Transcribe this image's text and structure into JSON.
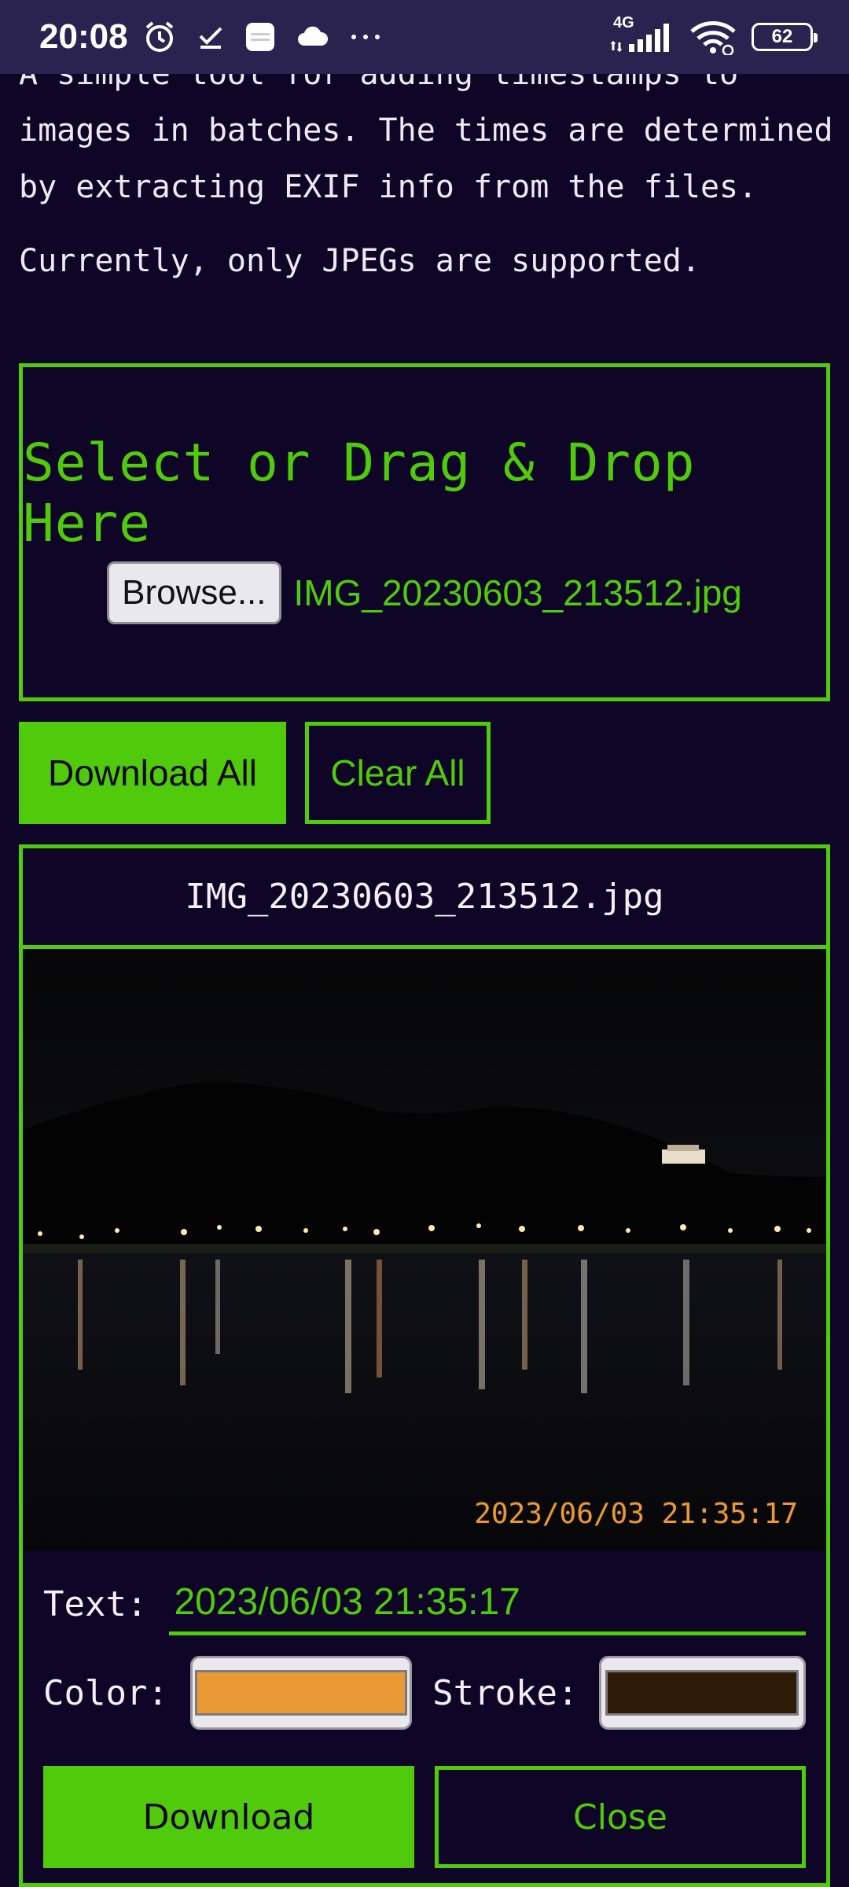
{
  "status_bar": {
    "time": "20:08",
    "network": "4G",
    "battery": "62",
    "icons_left": [
      "alarm-icon",
      "check-icon",
      "app-icon",
      "cloud-icon",
      "more-dots-icon"
    ],
    "icons_right": [
      "signal-icon",
      "wifi-icon",
      "battery-icon"
    ]
  },
  "intro": {
    "line1": "A simple tool for adding timestamps to images in batches. The times are determined by extracting EXIF info from the files.",
    "line2": "Currently, only JPEGs are supported."
  },
  "dropzone": {
    "title": "Select or Drag & Drop Here",
    "browse_label": "Browse...",
    "selected_file": "IMG_20230603_213512.jpg"
  },
  "actions": {
    "download_all": "Download All",
    "clear_all": "Clear All"
  },
  "card": {
    "filename": "IMG_20230603_213512.jpg",
    "stamp_text": "2023/06/03 21:35:17",
    "text_label": "Text:",
    "text_value": "2023/06/03 21:35:17",
    "color_label": "Color:",
    "color_value": "#e99a35",
    "stroke_label": "Stroke:",
    "stroke_value": "#2d1a07",
    "download_label": "Download",
    "close_label": "Close"
  },
  "colors": {
    "accent": "#4fcb0c",
    "background": "#0f0627",
    "status_bar": "#2a2350"
  }
}
